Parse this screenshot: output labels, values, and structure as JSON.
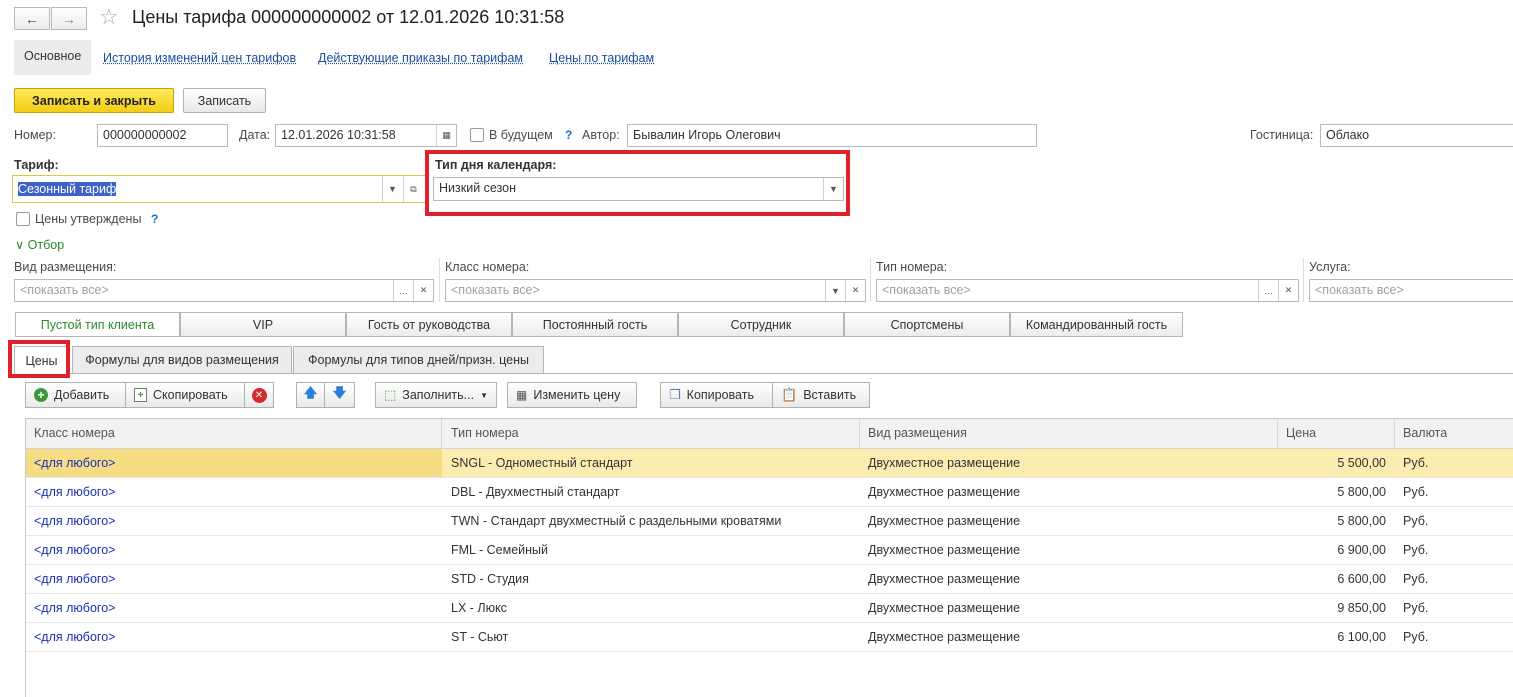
{
  "window": {
    "title": "Цены тарифа 000000000002 от 12.01.2026 10:31:58"
  },
  "nav": {
    "back": "←",
    "forward": "→",
    "star": "☆"
  },
  "top_tabs": [
    "Основное",
    "История изменений цен тарифов",
    "Действующие приказы по тарифам",
    "Цены по тарифам"
  ],
  "commands": {
    "save_close": "Записать и закрыть",
    "save": "Записать"
  },
  "form": {
    "number_label": "Номер:",
    "number_value": "000000000002",
    "date_label": "Дата:",
    "date_value": "12.01.2026 10:31:58",
    "future_label": "В будущем",
    "future_help": "?",
    "author_label": "Автор:",
    "author_value": "Бывалин Игорь Олегович",
    "hotel_label": "Гостиница:",
    "hotel_value": "Облако",
    "tariff_label": "Тариф:",
    "tariff_value": "Сезонный тариф",
    "daytype_label": "Тип дня календаря:",
    "daytype_value": "Низкий сезон",
    "prices_approved_label": "Цены утверждены",
    "prices_approved_help": "?",
    "filter_toggle": "Отбор"
  },
  "filters": [
    {
      "label": "Вид размещения:",
      "placeholder": "<показать все>"
    },
    {
      "label": "Класс номера:",
      "placeholder": "<показать все>"
    },
    {
      "label": "Тип номера:",
      "placeholder": "<показать все>"
    },
    {
      "label": "Услуга:",
      "placeholder": "<показать все>"
    }
  ],
  "client_types": [
    "Пустой тип клиента",
    "VIP",
    "Гость от руководства",
    "Постоянный гость",
    "Сотрудник",
    "Спортсмены",
    "Командированный гость"
  ],
  "content_tabs": [
    "Цены",
    "Формулы для видов размещения",
    "Формулы для типов дней/призн. цены"
  ],
  "toolbar": {
    "add": "Добавить",
    "copy": "Скопировать",
    "fill": "Заполнить...",
    "change_price": "Изменить цену",
    "copy2": "Копировать",
    "paste": "Вставить"
  },
  "table": {
    "columns": [
      "Класс номера",
      "Тип номера",
      "Вид размещения",
      "Цена",
      "Валюта"
    ],
    "rows": [
      [
        "<для любого>",
        "SNGL - Одноместный стандарт",
        "Двухместное размещение",
        "5 500,00",
        "Руб."
      ],
      [
        "<для любого>",
        "DBL - Двухместный стандарт",
        "Двухместное размещение",
        "5 800,00",
        "Руб."
      ],
      [
        "<для любого>",
        "TWN - Стандарт двухместный с раздельными кроватями",
        "Двухместное размещение",
        "5 800,00",
        "Руб."
      ],
      [
        "<для любого>",
        "FML - Семейный",
        "Двухместное размещение",
        "6 900,00",
        "Руб."
      ],
      [
        "<для любого>",
        "STD - Студия",
        "Двухместное размещение",
        "6 600,00",
        "Руб."
      ],
      [
        "<для любого>",
        "LX - Люкс",
        "Двухместное размещение",
        "9 850,00",
        "Руб."
      ],
      [
        "<для любого>",
        "ST - Сьют",
        "Двухместное размещение",
        "6 100,00",
        "Руб."
      ]
    ]
  },
  "colors": {
    "accent_yellow": "#f4cd14",
    "highlight_red": "#e0202a",
    "link_blue": "#1a4fa0",
    "selected_row": "#fbecb0"
  }
}
